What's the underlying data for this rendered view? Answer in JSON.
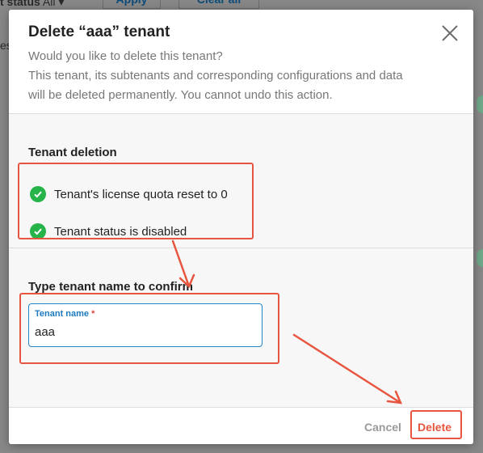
{
  "background": {
    "filter_label": "t status",
    "filter_value": "All",
    "apply_label": "Apply",
    "clear_label": "Clear all",
    "column_fragment": "es"
  },
  "dialog": {
    "title": "Delete “aaa” tenant",
    "description": [
      "Would you like to delete this tenant?",
      "This tenant, its subtenants and corresponding configurations and data",
      "will be deleted permanently. You cannot undo this action."
    ],
    "deletion_section": {
      "title": "Tenant deletion",
      "items": [
        "Tenant's license quota reset to 0",
        "Tenant status is disabled"
      ]
    },
    "confirm_section": {
      "title": "Type tenant name to confirm",
      "field_label": "Tenant name",
      "required_mark": "*",
      "field_value": "aaa"
    },
    "footer": {
      "cancel_label": "Cancel",
      "delete_label": "Delete"
    }
  },
  "colors": {
    "accent_blue": "#1e88c9",
    "success_green": "#25b34a",
    "danger": "#e8553f",
    "annotation": "#e8553f"
  }
}
